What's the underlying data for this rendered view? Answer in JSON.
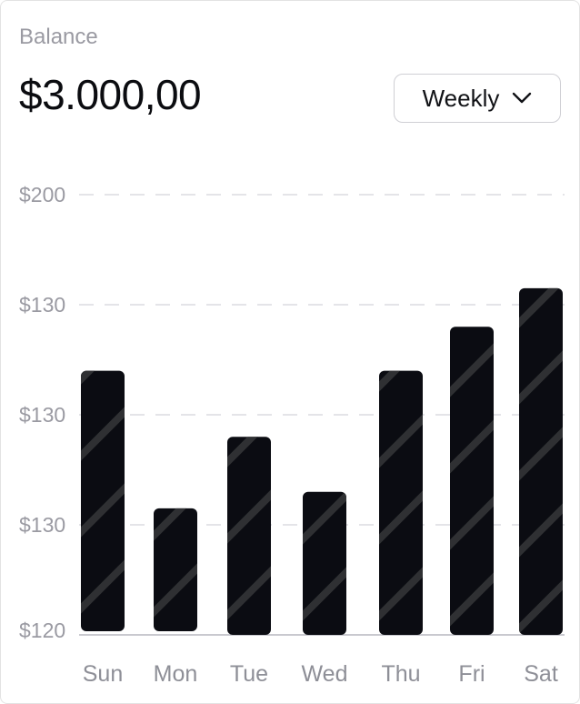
{
  "card": {
    "label": "Balance",
    "amount": "$3.000,00"
  },
  "period_dropdown": {
    "selected": "Weekly",
    "icon": "chevron-down-icon"
  },
  "colors": {
    "bar": "#0b0c12",
    "stripe": "#2f3033",
    "grid": "#e4e4e8",
    "text_muted": "#9a9aa2"
  },
  "chart_data": {
    "type": "bar",
    "categories": [
      "Sun",
      "Mon",
      "Tue",
      "Wed",
      "Thu",
      "Fri",
      "Sat"
    ],
    "values": [
      168,
      143,
      156,
      146,
      168,
      176,
      183
    ],
    "y_ticks": [
      "$200",
      "$130",
      "$130",
      "$130",
      "$120"
    ],
    "ylim": [
      120,
      200
    ],
    "grid": true,
    "bar_pattern": "diagonal-stripes"
  }
}
